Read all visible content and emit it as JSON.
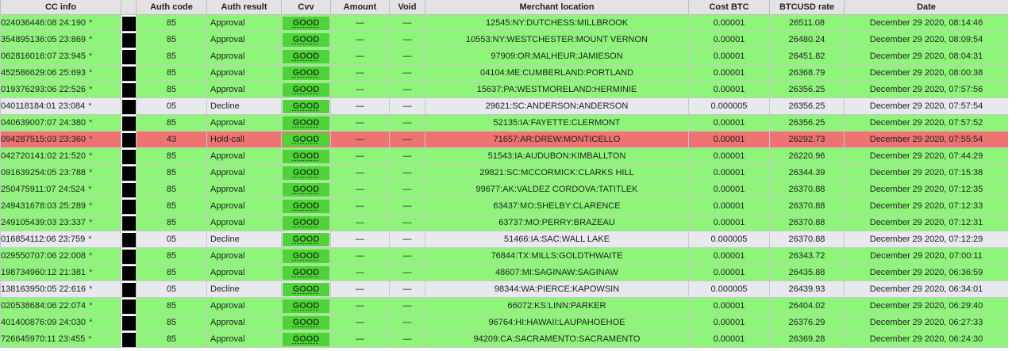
{
  "headers": {
    "cc_info": "CC info",
    "mask": "",
    "auth_code": "Auth code",
    "auth_result": "Auth result",
    "cvv": "Cvv",
    "amount": "Amount",
    "void": "Void",
    "merchant_location": "Merchant location",
    "cost_btc": "Cost BTC",
    "btcusd_rate": "BTCUSD rate",
    "date": "Date"
  },
  "colors": {
    "approval_row": "#8ef57a",
    "decline_row": "#e7e9ec",
    "hold_call_row": "#ed7470",
    "good_badge": "#4fd23a"
  },
  "rows": [
    {
      "cc": "024036446:08 24:190",
      "star": "*",
      "code": "85",
      "result": "Approval",
      "status": "approve",
      "cvv": "GOOD",
      "amount": "—",
      "void": "—",
      "location": "12545:NY:DUTCHESS:MILLBROOK",
      "cost": "0.00001",
      "rate": "26511.08",
      "date": "December 29 2020, 08:14:46"
    },
    {
      "cc": "354895136:05 23:869",
      "star": "*",
      "code": "85",
      "result": "Approval",
      "status": "approve",
      "cvv": "GOOD",
      "amount": "—",
      "void": "—",
      "location": "10553:NY:WESTCHESTER:MOUNT VERNON",
      "cost": "0.00001",
      "rate": "26480.24",
      "date": "December 29 2020, 08:09:54"
    },
    {
      "cc": "062816016:07 23:945",
      "star": "*",
      "code": "85",
      "result": "Approval",
      "status": "approve",
      "cvv": "GOOD",
      "amount": "—",
      "void": "—",
      "location": "97909:OR:MALHEUR:JAMIESON",
      "cost": "0.00001",
      "rate": "26451.82",
      "date": "December 29 2020, 08:04:31"
    },
    {
      "cc": "452586629:06 25:693",
      "star": "*",
      "code": "85",
      "result": "Approval",
      "status": "approve",
      "cvv": "GOOD",
      "amount": "—",
      "void": "—",
      "location": "04104:ME:CUMBERLAND:PORTLAND",
      "cost": "0.00001",
      "rate": "26368.79",
      "date": "December 29 2020, 08:00:38"
    },
    {
      "cc": "019376293:06 22:526",
      "star": "*",
      "code": "85",
      "result": "Approval",
      "status": "approve",
      "cvv": "GOOD",
      "amount": "—",
      "void": "—",
      "location": "15637:PA:WESTMORELAND:HERMINIE",
      "cost": "0.00001",
      "rate": "26356.25",
      "date": "December 29 2020, 07:57:56"
    },
    {
      "cc": "040118184:01 23:084",
      "star": "*",
      "code": "05",
      "result": "Decline",
      "status": "decline",
      "cvv": "GOOD",
      "amount": "—",
      "void": "—",
      "location": "29621:SC:ANDERSON:ANDERSON",
      "cost": "0.000005",
      "rate": "26356.25",
      "date": "December 29 2020, 07:57:54"
    },
    {
      "cc": "040639007:07 24:380",
      "star": "*",
      "code": "85",
      "result": "Approval",
      "status": "approve",
      "cvv": "GOOD",
      "amount": "—",
      "void": "—",
      "location": "52135:IA:FAYETTE:CLERMONT",
      "cost": "0.00001",
      "rate": "26356.25",
      "date": "December 29 2020, 07:57:52"
    },
    {
      "cc": "094287515:03 23:360",
      "star": "*",
      "code": "43",
      "result": "Hold-call",
      "status": "hold",
      "cvv": "GOOD",
      "amount": "—",
      "void": "—",
      "location": "71657:AR:DREW:MONTICELLO",
      "cost": "0.00001",
      "rate": "26292.73",
      "date": "December 29 2020, 07:55:54"
    },
    {
      "cc": "042720141:02 21:520",
      "star": "*",
      "code": "85",
      "result": "Approval",
      "status": "approve",
      "cvv": "GOOD",
      "amount": "—",
      "void": "—",
      "location": "51543:IA:AUDUBON:KIMBALLTON",
      "cost": "0.00001",
      "rate": "26220.96",
      "date": "December 29 2020, 07:44:29"
    },
    {
      "cc": "091639254:05 23:788",
      "star": "*",
      "code": "85",
      "result": "Approval",
      "status": "approve",
      "cvv": "GOOD",
      "amount": "—",
      "void": "—",
      "location": "29821:SC:MCCORMICK:CLARKS HILL",
      "cost": "0.00001",
      "rate": "26344.39",
      "date": "December 29 2020, 07:15:38"
    },
    {
      "cc": "250475911:07 24:524",
      "star": "*",
      "code": "85",
      "result": "Approval",
      "status": "approve",
      "cvv": "GOOD",
      "amount": "—",
      "void": "—",
      "location": "99677:AK:VALDEZ CORDOVA:TATITLEK",
      "cost": "0.00001",
      "rate": "26370.88",
      "date": "December 29 2020, 07:12:35"
    },
    {
      "cc": "249431678:03 25:289",
      "star": "*",
      "code": "85",
      "result": "Approval",
      "status": "approve",
      "cvv": "GOOD",
      "amount": "—",
      "void": "—",
      "location": "63437:MO:SHELBY:CLARENCE",
      "cost": "0.00001",
      "rate": "26370.88",
      "date": "December 29 2020, 07:12:33"
    },
    {
      "cc": "249105439:03 23:337",
      "star": "*",
      "code": "85",
      "result": "Approval",
      "status": "approve",
      "cvv": "GOOD",
      "amount": "—",
      "void": "—",
      "location": "63737:MO:PERRY:BRAZEAU",
      "cost": "0.00001",
      "rate": "26370.88",
      "date": "December 29 2020, 07:12:31"
    },
    {
      "cc": "016854112:06 23:759",
      "star": "*",
      "code": "05",
      "result": "Decline",
      "status": "decline",
      "cvv": "GOOD",
      "amount": "—",
      "void": "—",
      "location": "51466:IA:SAC:WALL LAKE",
      "cost": "0.000005",
      "rate": "26370.88",
      "date": "December 29 2020, 07:12:29"
    },
    {
      "cc": "029550707:06 22:008",
      "star": "*",
      "code": "85",
      "result": "Approval",
      "status": "approve",
      "cvv": "GOOD",
      "amount": "—",
      "void": "—",
      "location": "76844:TX:MILLS:GOLDTHWAITE",
      "cost": "0.00001",
      "rate": "26343.72",
      "date": "December 29 2020, 07:00:11"
    },
    {
      "cc": "198734960:12 21:381",
      "star": "*",
      "code": "85",
      "result": "Approval",
      "status": "approve",
      "cvv": "GOOD",
      "amount": "—",
      "void": "—",
      "location": "48607:MI:SAGINAW:SAGINAW",
      "cost": "0.00001",
      "rate": "26435.88",
      "date": "December 29 2020, 06:36:59"
    },
    {
      "cc": "138163950:05 22:616",
      "star": "*",
      "code": "05",
      "result": "Decline",
      "status": "decline",
      "cvv": "GOOD",
      "amount": "—",
      "void": "—",
      "location": "98344:WA:PIERCE:KAPOWSIN",
      "cost": "0.000005",
      "rate": "26439.93",
      "date": "December 29 2020, 06:34:01"
    },
    {
      "cc": "020538684:06 22:074",
      "star": "*",
      "code": "85",
      "result": "Approval",
      "status": "approve",
      "cvv": "GOOD",
      "amount": "—",
      "void": "—",
      "location": "66072:KS:LINN:PARKER",
      "cost": "0.00001",
      "rate": "26404.02",
      "date": "December 29 2020, 06:29:40"
    },
    {
      "cc": "401400876:09 24:030",
      "star": "*",
      "code": "85",
      "result": "Approval",
      "status": "approve",
      "cvv": "GOOD",
      "amount": "—",
      "void": "—",
      "location": "96764:HI:HAWAII:LAUPAHOEHOE",
      "cost": "0.00001",
      "rate": "26376.29",
      "date": "December 29 2020, 06:27:33"
    },
    {
      "cc": "726645970:11 23:455",
      "star": "*",
      "code": "85",
      "result": "Approval",
      "status": "approve",
      "cvv": "GOOD",
      "amount": "—",
      "void": "—",
      "location": "94209:CA:SACRAMENTO:SACRAMENTO",
      "cost": "0.00001",
      "rate": "26369.28",
      "date": "December 29 2020, 06:24:30"
    }
  ]
}
